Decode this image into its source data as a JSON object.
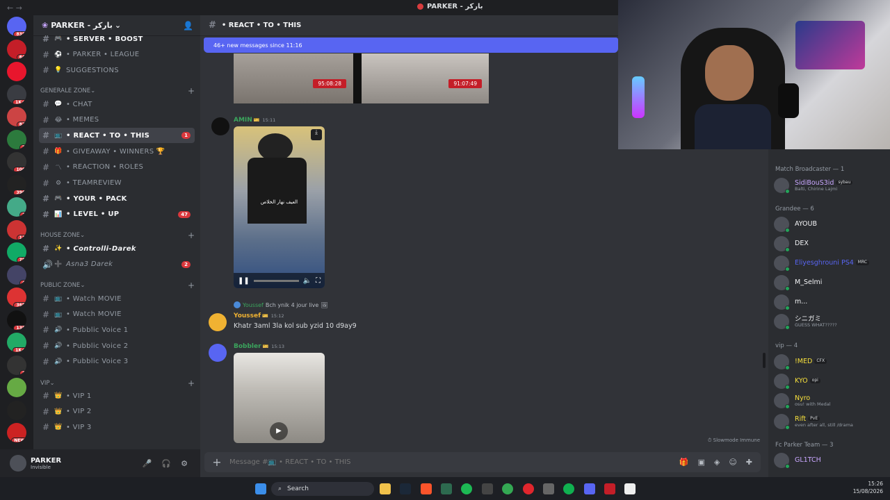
{
  "window": {
    "title": "PARKER - باركر",
    "back": "←",
    "forward": "→"
  },
  "server": {
    "name": "PARKER - باركر",
    "icon": "❀"
  },
  "channels_top": [
    {
      "emoji": "🎮",
      "label": "• SERVER • BOOST",
      "bright": true
    },
    {
      "emoji": "⚽",
      "label": "• PARKER • LEAGUE"
    },
    {
      "emoji": "💡",
      "label": "SUGGESTIONS"
    }
  ],
  "categories": {
    "generale": "GENERALE ZONE",
    "house": "HOUSE ZONE",
    "public": "PUBLIC ZONE",
    "vip": "VIP"
  },
  "generale_channels": [
    {
      "emoji": "💬",
      "label": "• CHAT"
    },
    {
      "emoji": "😂",
      "label": "• MEMES"
    },
    {
      "emoji": "📺",
      "label": "• REACT • TO • THIS",
      "selected": true,
      "count": "1"
    },
    {
      "emoji": "🎁",
      "label": "• GIVEAWAY • WINNERS 🏆"
    },
    {
      "emoji": "〽",
      "label": "• REACTION • ROLES"
    },
    {
      "emoji": "⚙",
      "label": "• TEAMREVIEW"
    },
    {
      "emoji": "🎮",
      "label": "• YOUR • PACK",
      "bright": true
    },
    {
      "emoji": "📊",
      "label": "• LEVEL • UP",
      "bright": true,
      "count": "47"
    }
  ],
  "house_channels": [
    {
      "emoji": "✨",
      "label": "• Controlli-Darek",
      "bright": true,
      "italic": true
    },
    {
      "emoji": "➕",
      "label": "Asna3 Darek",
      "italic": true,
      "count": "2",
      "voice": true
    }
  ],
  "public_channels": [
    {
      "emoji": "📺",
      "label": "• Watch MOVIE"
    },
    {
      "emoji": "📺",
      "label": "• Watch MOVIE"
    },
    {
      "emoji": "🔊",
      "label": "• Pubblic Voice 1"
    },
    {
      "emoji": "🔊",
      "label": "• Pubblic Voice 2"
    },
    {
      "emoji": "🔊",
      "label": "• Pubblic Voice 3"
    }
  ],
  "vip_channels": [
    {
      "emoji": "👑",
      "label": "• VIP 1"
    },
    {
      "emoji": "👑",
      "label": "• VIP 2"
    },
    {
      "emoji": "👑",
      "label": "• VIP 3"
    }
  ],
  "user": {
    "name": "PARKER",
    "status": "Invisible"
  },
  "servers": [
    {
      "badge": "835"
    },
    {
      "badge": "64"
    },
    {
      "badge": ""
    },
    {
      "badge": "1K+"
    },
    {
      "badge": "87"
    },
    {
      "badge": "7"
    },
    {
      "badge": "106"
    },
    {
      "badge": "396"
    },
    {
      "badge": "1"
    },
    {
      "badge": "11"
    },
    {
      "badge": "78"
    },
    {
      "badge": "4"
    },
    {
      "badge": "365"
    },
    {
      "badge": "135"
    },
    {
      "badge": "1K+"
    },
    {
      "badge": "3"
    },
    {
      "badge": ""
    },
    {
      "badge": ""
    },
    {
      "badge": "NEW"
    }
  ],
  "channel_header": {
    "name": "• REACT • TO • THIS"
  },
  "new_messages": "46+ new messages since 11:16",
  "thumbs": [
    {
      "time": "95:08:28"
    },
    {
      "time": "91:07:49"
    }
  ],
  "messages": [
    {
      "author": "AMIN",
      "badge": "🎫",
      "time": "15:11"
    },
    {
      "reply_author": "Youssef",
      "reply_text": "Bch ynik 4 jour live",
      "author": "Youssef",
      "badge": "🎫",
      "time": "15:12",
      "text": "Khatr 3aml 3la kol sub yzid 10 d9ay9"
    },
    {
      "author": "Bobbler",
      "badge": "🎫",
      "time": "15:13"
    }
  ],
  "video_overlay_text": "العيف نهار الخلاص",
  "composer": {
    "placeholder": "Message #📺 • REACT • TO • THIS"
  },
  "slowmode": "Slowmode Immune",
  "members": {
    "groups": [
      {
        "title": "Match Broadcaster — 1"
      },
      {
        "title": "Grandee — 6"
      },
      {
        "title": "vip — 4"
      },
      {
        "title": "Fc Parker Team — 3"
      }
    ],
    "list": [
      {
        "name": "SidiBouS3id",
        "tag": "sybau",
        "sub": "Balti, Chirine Lajmi",
        "color": "#c9a7ff"
      },
      {
        "name": "AYOUB",
        "sub": "",
        "color": "#f2f3f5"
      },
      {
        "name": "DEX",
        "sub": "",
        "color": "#f2f3f5"
      },
      {
        "name": "Eliyesghrouni PS4",
        "tag": "MRC",
        "sub": "",
        "color": "#5865f2"
      },
      {
        "name": "M_Selmi",
        "sub": "",
        "color": "#f2f3f5"
      },
      {
        "name": "m...",
        "sub": "",
        "color": "#f2f3f5"
      },
      {
        "name": "シニガミ",
        "sub": "GUESS WHAT?????",
        "color": "#f2f3f5"
      },
      {
        "name": "!MED",
        "tag": "CFX",
        "sub": "",
        "color": "#f7e03c"
      },
      {
        "name": "KYO",
        "tag": "opi",
        "sub": "",
        "color": "#f7e03c"
      },
      {
        "name": "Nyro",
        "sub": "osu! with Medal",
        "color": "#f7e03c"
      },
      {
        "name": "Rift",
        "tag": "PvE",
        "sub": "even after all, still /drama",
        "color": "#f7e03c"
      },
      {
        "name": "GL1TCH",
        "sub": "",
        "color": "#c9a7ff"
      }
    ]
  },
  "taskbar": {
    "search": "Search",
    "time": "15:26",
    "date": "15/08/2026"
  }
}
